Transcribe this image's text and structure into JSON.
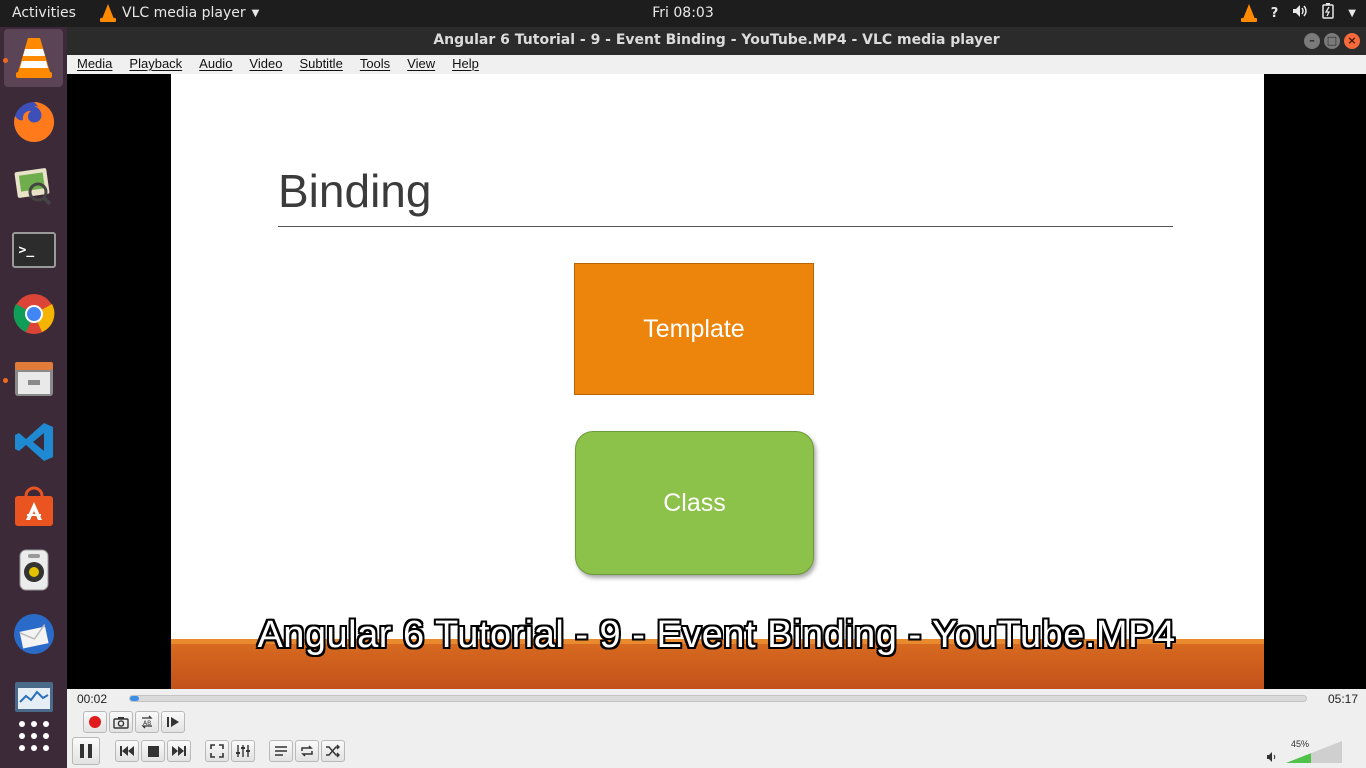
{
  "topbar": {
    "activities": "Activities",
    "app_menu": "VLC media player",
    "clock": "Fri 08:03",
    "help": "?"
  },
  "window": {
    "title": "Angular 6 Tutorial - 9 - Event Binding - YouTube.MP4 - VLC media player"
  },
  "menu": {
    "items": [
      "Media",
      "Playback",
      "Audio",
      "Video",
      "Subtitle",
      "Tools",
      "View",
      "Help"
    ]
  },
  "slide": {
    "heading": "Binding",
    "box_top": "Template",
    "box_bottom": "Class",
    "colors": {
      "template": "#ed840b",
      "class": "#8cc24a",
      "band": "#c9581d"
    }
  },
  "subtitle": "Angular 6 Tutorial - 9 - Event Binding - YouTube.MP4",
  "player": {
    "elapsed": "00:02",
    "total": "05:17",
    "progress_fraction": 0.006,
    "volume_label": "45%",
    "volume_fraction": 0.45,
    "accent": "#3a8ee6"
  },
  "dock": {
    "apps": [
      "vlc-icon",
      "firefox-icon",
      "image-viewer-icon",
      "terminal-icon",
      "chrome-icon",
      "files-icon",
      "vscode-icon",
      "software-center-icon",
      "rhythmbox-icon",
      "thunderbird-icon",
      "system-monitor-icon",
      "app-grid-icon"
    ]
  }
}
